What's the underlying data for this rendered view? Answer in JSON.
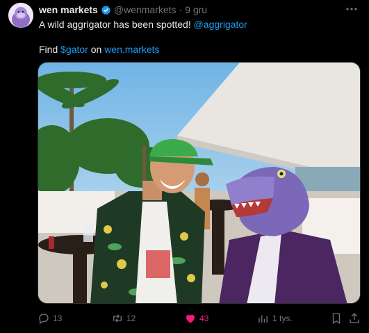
{
  "author": {
    "name": "wen markets",
    "handle": "@wenmarkets",
    "separator": "·",
    "time": "9 gru",
    "verified_color": "#1d9bf0"
  },
  "tweet": {
    "line1_text": "A wild aggrigator has been spotted! ",
    "line1_mention": "@aggrigator",
    "line2_prefix": "Find ",
    "line2_cashtag": "$gator",
    "line2_middle": " on ",
    "line2_link": "wen.markets"
  },
  "media": {
    "description_icon": "photo"
  },
  "actions": {
    "replies": "13",
    "reposts": "12",
    "likes": "43",
    "views": "1 tys.",
    "like_color": "#f91880"
  },
  "colors": {
    "background": "#000000",
    "text": "#e7e9ea",
    "secondary": "#71767b",
    "accent": "#1d9bf0"
  }
}
